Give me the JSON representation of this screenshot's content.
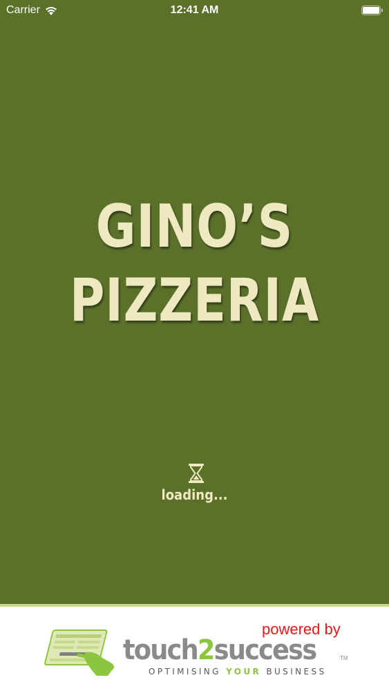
{
  "status_bar": {
    "carrier": "Carrier",
    "time": "12:41 AM",
    "icons": [
      "wifi-icon",
      "battery-icon"
    ]
  },
  "brand": {
    "line1": "GINO’S",
    "line2": "PIZZERIA"
  },
  "loading": {
    "icon": "hourglass-icon",
    "text": "loading..."
  },
  "footer": {
    "powered_by": "powered by",
    "logo_text_pre": "touch",
    "logo_text_two": "2",
    "logo_text_post": "success",
    "trademark": "TM",
    "tagline_pre": "OPTIMISING ",
    "tagline_your": "YOUR",
    "tagline_post": " BUSINESS",
    "logo_icon": "touch2success-logo-icon"
  },
  "colors": {
    "background": "#5b712a",
    "brand_text": "#efe9c2",
    "powered_by": "#e01b1b",
    "accent_green": "#8cc63f",
    "logo_gray": "#8a8a8a"
  }
}
